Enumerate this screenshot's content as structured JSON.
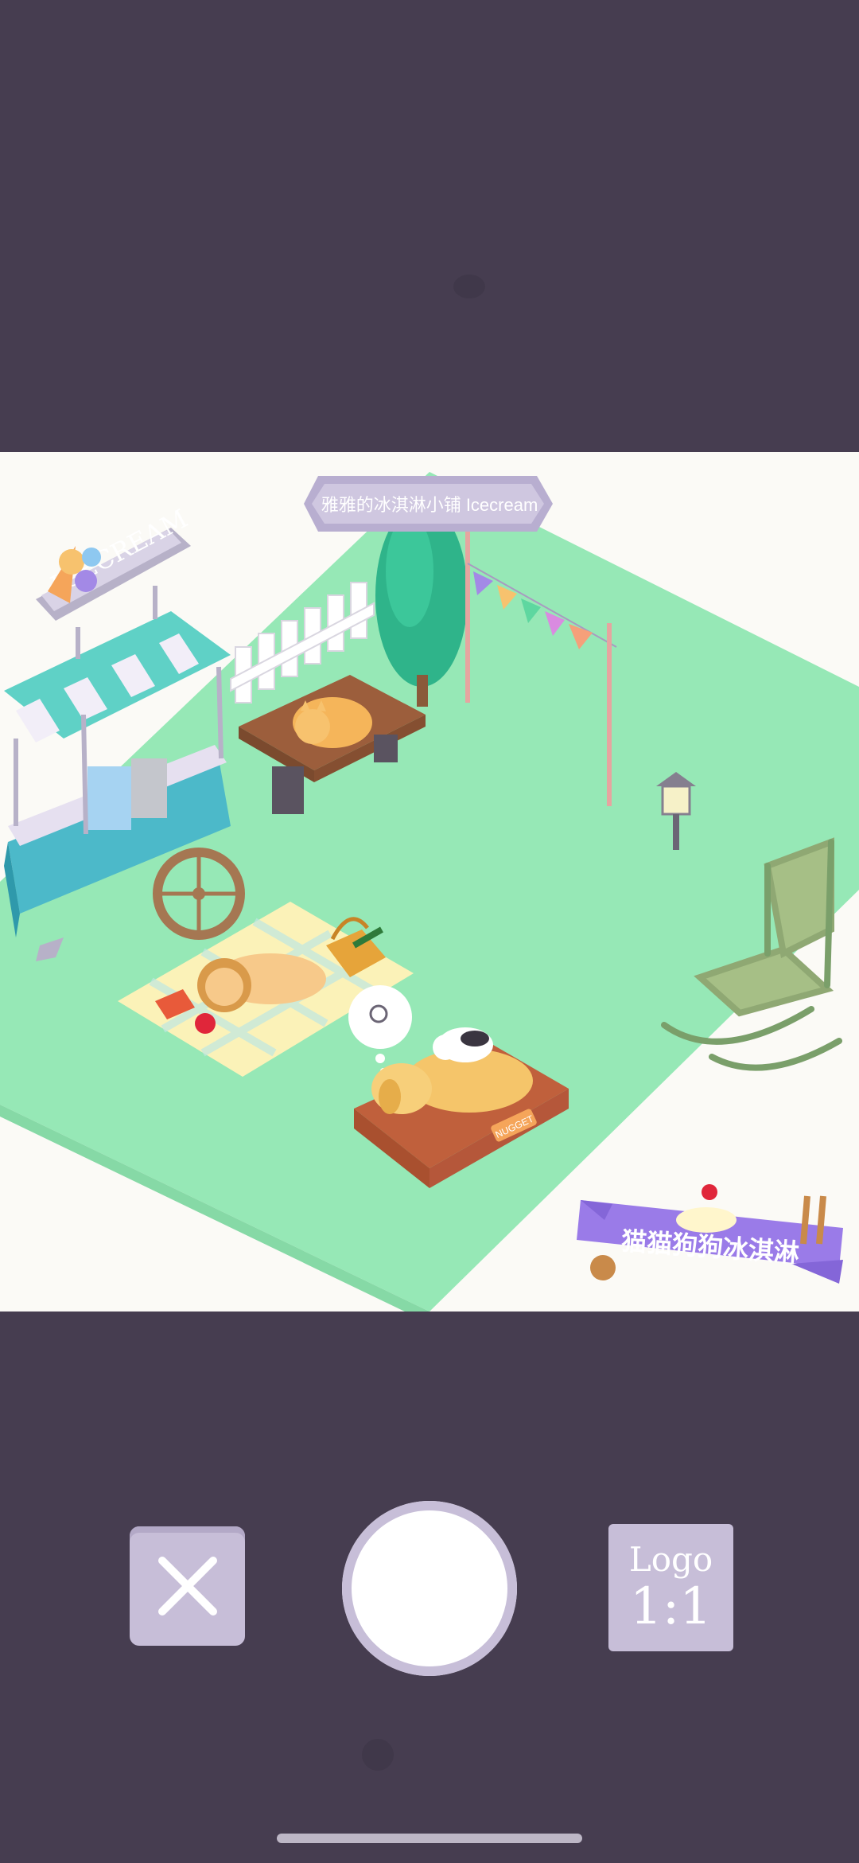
{
  "colors": {
    "background": "#463d50",
    "grass": "#96e8b6",
    "sign": "#c7bed8",
    "accent_purple": "#9a7be8"
  },
  "scene": {
    "shop_sign": "雅雅的冰淇淋小铺 Icecream",
    "cart_sign": "ICECREAM",
    "game_logo": "猫猫狗狗冰淇淋",
    "bed_label": "NUGGET"
  },
  "controls": {
    "close_icon": "close-icon",
    "ratio_top": "Logo",
    "ratio_bottom": "1:1"
  }
}
